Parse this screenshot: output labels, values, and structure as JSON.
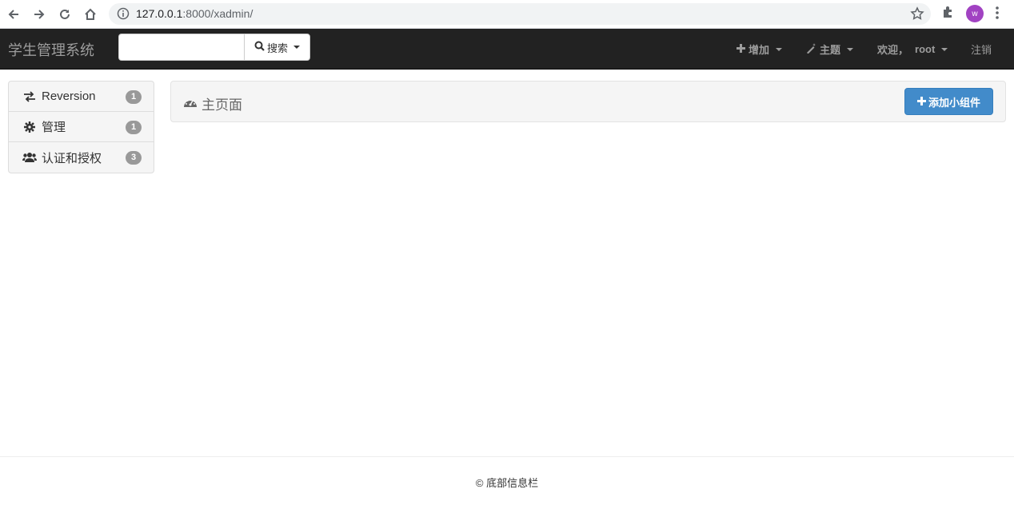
{
  "browser": {
    "url_host": "127.0.0.1",
    "url_rest": ":8000/xadmin/",
    "profile_initial": "w",
    "profile_color": "#a142c2"
  },
  "navbar": {
    "brand": "学生管理系统",
    "search_button": "搜索",
    "search_value": "",
    "add_label": "增加",
    "theme_label": "主题",
    "welcome_label": "欢迎，",
    "user_name": "root",
    "logout_label": "注销",
    "background": "#222222"
  },
  "sidebar": {
    "items": [
      {
        "label": "Reversion",
        "icon": "exchange-icon",
        "count": "1"
      },
      {
        "label": "管理",
        "icon": "gear-icon",
        "count": "1"
      },
      {
        "label": "认证和授权",
        "icon": "users-icon",
        "count": "3"
      }
    ]
  },
  "main": {
    "title": "主页面",
    "title_icon": "dashboard-icon",
    "add_widget_label": "添加小组件",
    "accent": "#428bca"
  },
  "footer": {
    "text": "© 底部信息栏"
  }
}
